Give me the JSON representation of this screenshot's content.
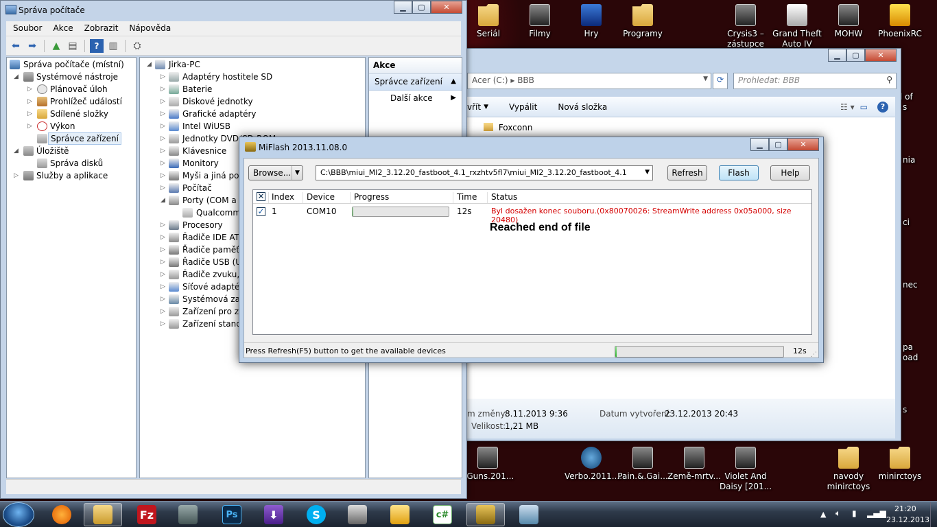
{
  "desktop": {
    "icons": [
      {
        "label": "Seriál",
        "kind": "folder"
      },
      {
        "label": "Filmy",
        "kind": "video"
      },
      {
        "label": "Hry",
        "kind": "game"
      },
      {
        "label": "Programy",
        "kind": "folder"
      },
      {
        "label": "Crysis3 – zástupce",
        "kind": "game"
      },
      {
        "label": "Grand Theft Auto IV",
        "kind": "game"
      },
      {
        "label": "MOHW",
        "kind": "game"
      },
      {
        "label": "PhoenixRC",
        "kind": "app"
      }
    ],
    "bottom_icons": [
      {
        "label": "..Guns.201..."
      },
      {
        "label": "Verbo.2011...."
      },
      {
        "label": "Pain.&.Gai..."
      },
      {
        "label": "Země-mrtv..."
      },
      {
        "label": "Violet And Daisy [201..."
      },
      {
        "label": "navody minirctoys"
      },
      {
        "label": "minirctoys"
      }
    ],
    "right_partial": [
      "l of",
      "s",
      "nia",
      "ci",
      "nec",
      "pa",
      "oad",
      "s"
    ]
  },
  "comp_mgmt": {
    "title": "Správa počítače",
    "menu": [
      "Soubor",
      "Akce",
      "Zobrazit",
      "Nápověda"
    ],
    "left_tree": [
      {
        "label": "Správa počítače (místní)",
        "level": 0
      },
      {
        "label": "Systémové nástroje",
        "level": 1
      },
      {
        "label": "Plánovač úloh",
        "level": 2
      },
      {
        "label": "Prohlížeč událostí",
        "level": 2
      },
      {
        "label": "Sdílené složky",
        "level": 2
      },
      {
        "label": "Výkon",
        "level": 2
      },
      {
        "label": "Správce zařízení",
        "level": 2,
        "selected": true
      },
      {
        "label": "Úložiště",
        "level": 1
      },
      {
        "label": "Správa disků",
        "level": 2
      },
      {
        "label": "Služby a aplikace",
        "level": 1
      }
    ],
    "device_tree": [
      "Jirka-PC",
      "Adaptéry hostitele SD",
      "Baterie",
      "Diskové jednotky",
      "Grafické adaptéry",
      "Intel WiUSB",
      "Jednotky DVD/CD-ROM",
      "Klávesnice",
      "Monitory",
      "Myši a jiná polo",
      "Počítač",
      "Porty (COM a L",
      "Qualcomm",
      "Procesory",
      "Řadiče IDE ATA",
      "Řadiče paměťo",
      "Řadiče USB (Un",
      "Řadiče zvuku, v",
      "Síťové adaptéry",
      "Systémová zaříz",
      "Zařízení pro zpr",
      "Zařízení standar"
    ],
    "actions": {
      "header": "Akce",
      "section": "Správce zařízení",
      "more": "Další akce"
    }
  },
  "explorer": {
    "breadcrumb": [
      "Acer (C:)",
      "BBB"
    ],
    "search_placeholder": "Prohledat: BBB",
    "commands": [
      "vřít",
      "Vypálit",
      "Nová složka"
    ],
    "items": [
      "Foxconn"
    ],
    "details": {
      "modified_label": "m změny:",
      "modified_value": "8.11.2013 9:36",
      "created_label": "Datum vytvoření:",
      "created_value": "23.12.2013 20:43",
      "size_label": "Velikost:",
      "size_value": "1,21 MB"
    }
  },
  "miflash": {
    "title": "MiFlash 2013.11.08.0",
    "browse_label": "Browse...",
    "path": "C:\\BBB\\miui_MI2_3.12.20_fastboot_4.1_rxzhtv5fl7\\miui_MI2_3.12.20_fastboot_4.1",
    "refresh_label": "Refresh",
    "flash_label": "Flash",
    "help_label": "Help",
    "columns": [
      "Index",
      "Device",
      "Progress",
      "Time",
      "Status"
    ],
    "rows": [
      {
        "index": "1",
        "device": "COM10",
        "progress": 0.01,
        "time": "12s",
        "status": "Byl dosažen konec souboru.(0x80070026: StreamWrite address 0x05a000, size 20480)",
        "status_color": "#d40000"
      }
    ],
    "annotation": "Reached end of file",
    "statusbar_text": "Press Refresh(F5) button to get the available devices",
    "statusbar_progress": 0.01,
    "statusbar_time": "12s"
  },
  "taskbar": {
    "apps": [
      "start-orb",
      "firefox",
      "explorer",
      "filezilla",
      "computer-mgmt",
      "photoshop",
      "downloader",
      "skype",
      "usb-tool",
      "mail",
      "csharp",
      "miflash",
      "remote"
    ],
    "clock_time": "21:20",
    "clock_date": "23.12.2013"
  }
}
